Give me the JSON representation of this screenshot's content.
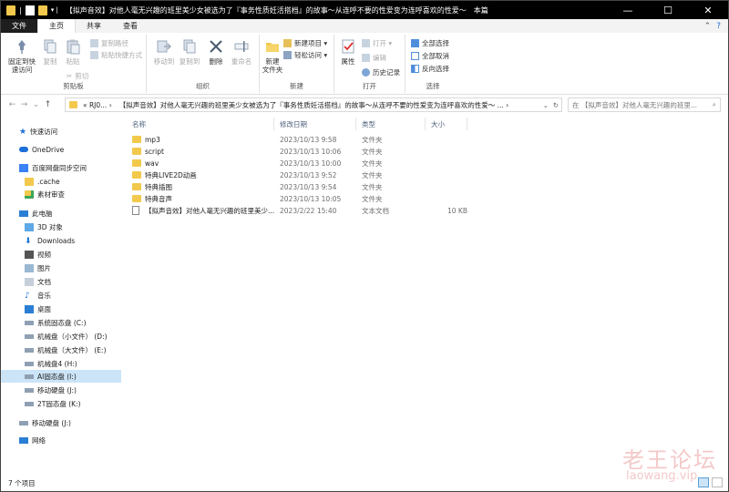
{
  "window": {
    "title": "【拟声音效】对他人毫无兴趣的班里美少女被选为了『事务性质妊活搭档』的故事～从连呼不要的性爱变为连呼喜欢的性爱～　本篇",
    "minimize": "—",
    "maximize": "☐",
    "close": "✕"
  },
  "tabs": {
    "file": "文件",
    "home": "主页",
    "share": "共享",
    "view": "查看"
  },
  "ribbon": {
    "clipboard": {
      "label": "剪贴板",
      "pin": "固定到快\n速访问",
      "copy": "复制",
      "paste": "粘贴",
      "copy_path": "复制路径",
      "paste_shortcut": "粘贴快捷方式",
      "cut": "剪切"
    },
    "organize": {
      "label": "组织",
      "move_to": "移动到",
      "copy_to": "复制到",
      "delete": "删除",
      "rename": "重命名"
    },
    "new": {
      "label": "新建",
      "new_folder": "新建\n文件夹",
      "new_item": "新建项目 ▾",
      "easy_access": "轻松访问 ▾"
    },
    "open": {
      "label": "打开",
      "properties": "属性",
      "open": "打开 ▾",
      "edit": "编辑",
      "history": "历史记录"
    },
    "select": {
      "label": "选择",
      "select_all": "全部选择",
      "select_none": "全部取消",
      "invert": "反向选择"
    }
  },
  "address": {
    "path_prefix": "«  RJ0...  ›",
    "path": "【拟声音效】对他人毫无兴趣的班里美少女被选为了『事务性质妊活搭档』的故事～从连呼不要的性爱变为连呼喜欢的性爱～  ...  ›",
    "search_placeholder": "在 【拟声音效】对他人毫无兴趣的班里..."
  },
  "nav": {
    "quick_access": "快速访问",
    "onedrive": "OneDrive",
    "baidu": "百度网盘同步空间",
    "cache": ".cache",
    "review": "素材审查",
    "this_pc": "此电脑",
    "objects3d": "3D 对象",
    "downloads": "Downloads",
    "videos": "视频",
    "pictures": "图片",
    "documents": "文档",
    "music": "音乐",
    "desktop": "桌面",
    "drive_c": "系统固态盘 (C:)",
    "drive_d": "机械盘（小文件） (D:)",
    "drive_e": "机械盘（大文件） (E:)",
    "drive_h": "机械盘4 (H:)",
    "drive_i": "AI固态盘 (I:)",
    "drive_j": "移动硬盘 (J:)",
    "drive_k": "2T固态盘 (K:)",
    "drive_j2": "移动硬盘 (J:)",
    "network": "网络"
  },
  "columns": {
    "name": "名称",
    "date": "修改日期",
    "type": "类型",
    "size": "大小"
  },
  "files": [
    {
      "name": "mp3",
      "date": "2023/10/13 9:58",
      "type": "文件夹",
      "size": ""
    },
    {
      "name": "script",
      "date": "2023/10/13 10:06",
      "type": "文件夹",
      "size": ""
    },
    {
      "name": "wav",
      "date": "2023/10/13 10:00",
      "type": "文件夹",
      "size": ""
    },
    {
      "name": "特典LIVE2D动画",
      "date": "2023/10/13 9:52",
      "type": "文件夹",
      "size": ""
    },
    {
      "name": "特典插图",
      "date": "2023/10/13 9:54",
      "type": "文件夹",
      "size": ""
    },
    {
      "name": "特典音声",
      "date": "2023/10/13 10:05",
      "type": "文件夹",
      "size": ""
    },
    {
      "name": "【拟声音效】对他人毫无兴趣的班里美少...",
      "date": "2023/2/22 15:40",
      "type": "文本文档",
      "size": "10 KB"
    }
  ],
  "status": {
    "count": "7 个项目"
  },
  "watermark": {
    "cn": "老王论坛",
    "en": "laowang.vip"
  },
  "colors": {
    "titlebar": "#000000",
    "accent": "#1e6fd9",
    "folder": "#f2c94c",
    "selection": "#cce4f7"
  }
}
